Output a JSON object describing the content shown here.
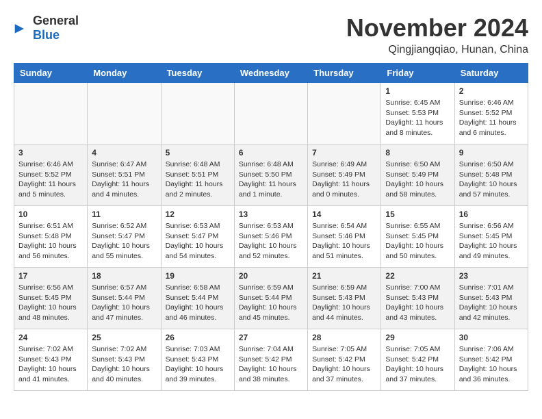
{
  "logo": {
    "general": "General",
    "blue": "Blue"
  },
  "title": {
    "month": "November 2024",
    "location": "Qingjiangqiao, Hunan, China"
  },
  "headers": [
    "Sunday",
    "Monday",
    "Tuesday",
    "Wednesday",
    "Thursday",
    "Friday",
    "Saturday"
  ],
  "weeks": [
    [
      {
        "day": "",
        "info": ""
      },
      {
        "day": "",
        "info": ""
      },
      {
        "day": "",
        "info": ""
      },
      {
        "day": "",
        "info": ""
      },
      {
        "day": "",
        "info": ""
      },
      {
        "day": "1",
        "info": "Sunrise: 6:45 AM\nSunset: 5:53 PM\nDaylight: 11 hours and 8 minutes."
      },
      {
        "day": "2",
        "info": "Sunrise: 6:46 AM\nSunset: 5:52 PM\nDaylight: 11 hours and 6 minutes."
      }
    ],
    [
      {
        "day": "3",
        "info": "Sunrise: 6:46 AM\nSunset: 5:52 PM\nDaylight: 11 hours and 5 minutes."
      },
      {
        "day": "4",
        "info": "Sunrise: 6:47 AM\nSunset: 5:51 PM\nDaylight: 11 hours and 4 minutes."
      },
      {
        "day": "5",
        "info": "Sunrise: 6:48 AM\nSunset: 5:51 PM\nDaylight: 11 hours and 2 minutes."
      },
      {
        "day": "6",
        "info": "Sunrise: 6:48 AM\nSunset: 5:50 PM\nDaylight: 11 hours and 1 minute."
      },
      {
        "day": "7",
        "info": "Sunrise: 6:49 AM\nSunset: 5:49 PM\nDaylight: 11 hours and 0 minutes."
      },
      {
        "day": "8",
        "info": "Sunrise: 6:50 AM\nSunset: 5:49 PM\nDaylight: 10 hours and 58 minutes."
      },
      {
        "day": "9",
        "info": "Sunrise: 6:50 AM\nSunset: 5:48 PM\nDaylight: 10 hours and 57 minutes."
      }
    ],
    [
      {
        "day": "10",
        "info": "Sunrise: 6:51 AM\nSunset: 5:48 PM\nDaylight: 10 hours and 56 minutes."
      },
      {
        "day": "11",
        "info": "Sunrise: 6:52 AM\nSunset: 5:47 PM\nDaylight: 10 hours and 55 minutes."
      },
      {
        "day": "12",
        "info": "Sunrise: 6:53 AM\nSunset: 5:47 PM\nDaylight: 10 hours and 54 minutes."
      },
      {
        "day": "13",
        "info": "Sunrise: 6:53 AM\nSunset: 5:46 PM\nDaylight: 10 hours and 52 minutes."
      },
      {
        "day": "14",
        "info": "Sunrise: 6:54 AM\nSunset: 5:46 PM\nDaylight: 10 hours and 51 minutes."
      },
      {
        "day": "15",
        "info": "Sunrise: 6:55 AM\nSunset: 5:45 PM\nDaylight: 10 hours and 50 minutes."
      },
      {
        "day": "16",
        "info": "Sunrise: 6:56 AM\nSunset: 5:45 PM\nDaylight: 10 hours and 49 minutes."
      }
    ],
    [
      {
        "day": "17",
        "info": "Sunrise: 6:56 AM\nSunset: 5:45 PM\nDaylight: 10 hours and 48 minutes."
      },
      {
        "day": "18",
        "info": "Sunrise: 6:57 AM\nSunset: 5:44 PM\nDaylight: 10 hours and 47 minutes."
      },
      {
        "day": "19",
        "info": "Sunrise: 6:58 AM\nSunset: 5:44 PM\nDaylight: 10 hours and 46 minutes."
      },
      {
        "day": "20",
        "info": "Sunrise: 6:59 AM\nSunset: 5:44 PM\nDaylight: 10 hours and 45 minutes."
      },
      {
        "day": "21",
        "info": "Sunrise: 6:59 AM\nSunset: 5:43 PM\nDaylight: 10 hours and 44 minutes."
      },
      {
        "day": "22",
        "info": "Sunrise: 7:00 AM\nSunset: 5:43 PM\nDaylight: 10 hours and 43 minutes."
      },
      {
        "day": "23",
        "info": "Sunrise: 7:01 AM\nSunset: 5:43 PM\nDaylight: 10 hours and 42 minutes."
      }
    ],
    [
      {
        "day": "24",
        "info": "Sunrise: 7:02 AM\nSunset: 5:43 PM\nDaylight: 10 hours and 41 minutes."
      },
      {
        "day": "25",
        "info": "Sunrise: 7:02 AM\nSunset: 5:43 PM\nDaylight: 10 hours and 40 minutes."
      },
      {
        "day": "26",
        "info": "Sunrise: 7:03 AM\nSunset: 5:43 PM\nDaylight: 10 hours and 39 minutes."
      },
      {
        "day": "27",
        "info": "Sunrise: 7:04 AM\nSunset: 5:42 PM\nDaylight: 10 hours and 38 minutes."
      },
      {
        "day": "28",
        "info": "Sunrise: 7:05 AM\nSunset: 5:42 PM\nDaylight: 10 hours and 37 minutes."
      },
      {
        "day": "29",
        "info": "Sunrise: 7:05 AM\nSunset: 5:42 PM\nDaylight: 10 hours and 37 minutes."
      },
      {
        "day": "30",
        "info": "Sunrise: 7:06 AM\nSunset: 5:42 PM\nDaylight: 10 hours and 36 minutes."
      }
    ]
  ]
}
